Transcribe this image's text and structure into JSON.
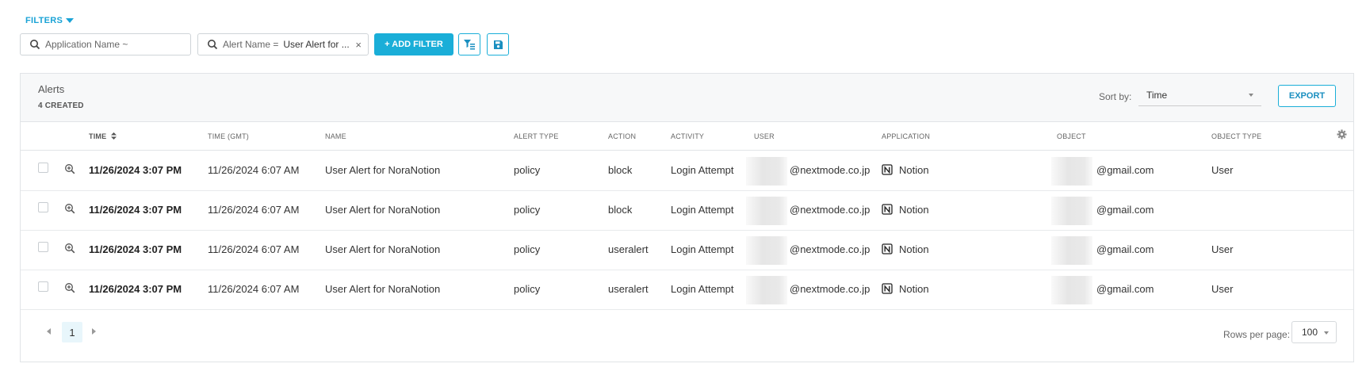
{
  "filters": {
    "label": "FILTERS",
    "search_placeholder": "Application Name ~",
    "alert_filter_key": "Alert Name =",
    "alert_filter_value": "User Alert for ...",
    "clear_symbol": "×",
    "add_filter_label": "+ ADD FILTER"
  },
  "panel": {
    "title": "Alerts",
    "subtitle": "4 CREATED",
    "sort_label": "Sort by:",
    "sort_value": "Time",
    "export_label": "EXPORT"
  },
  "table": {
    "headers": {
      "time": "TIME",
      "time_gmt": "TIME (GMT)",
      "name": "NAME",
      "alert_type": "ALERT TYPE",
      "action": "ACTION",
      "activity": "ACTIVITY",
      "user": "USER",
      "application": "APPLICATION",
      "object": "OBJECT",
      "object_type": "OBJECT TYPE"
    },
    "rows": [
      {
        "time": "11/26/2024 3:07 PM",
        "time_gmt": "11/26/2024 6:07 AM",
        "name": "User Alert for NoraNotion",
        "alert_type": "policy",
        "action": "block",
        "activity": "Login Attempt",
        "user": "@nextmode.co.jp",
        "application": "Notion",
        "object": "@gmail.com",
        "object_type": "User"
      },
      {
        "time": "11/26/2024 3:07 PM",
        "time_gmt": "11/26/2024 6:07 AM",
        "name": "User Alert for NoraNotion",
        "alert_type": "policy",
        "action": "block",
        "activity": "Login Attempt",
        "user": "@nextmode.co.jp",
        "application": "Notion",
        "object": "@gmail.com",
        "object_type": ""
      },
      {
        "time": "11/26/2024 3:07 PM",
        "time_gmt": "11/26/2024 6:07 AM",
        "name": "User Alert for NoraNotion",
        "alert_type": "policy",
        "action": "useralert",
        "activity": "Login Attempt",
        "user": "@nextmode.co.jp",
        "application": "Notion",
        "object": "@gmail.com",
        "object_type": "User"
      },
      {
        "time": "11/26/2024 3:07 PM",
        "time_gmt": "11/26/2024 6:07 AM",
        "name": "User Alert for NoraNotion",
        "alert_type": "policy",
        "action": "useralert",
        "activity": "Login Attempt",
        "user": "@nextmode.co.jp",
        "application": "Notion",
        "object": "@gmail.com",
        "object_type": "User"
      }
    ]
  },
  "pagination": {
    "current_page": "1",
    "rows_per_page_label": "Rows per page:",
    "rows_per_page_value": "100"
  },
  "colors": {
    "accent": "#1aaed8",
    "header_bg": "#f7f8f9",
    "border": "#e1e4e7"
  },
  "icons": [
    "search-icon",
    "filter-list-icon",
    "save-icon",
    "sort-icon",
    "gear-icon",
    "zoom-in-icon",
    "notion-icon",
    "chevron-left-icon",
    "chevron-right-icon",
    "caret-down-icon"
  ]
}
